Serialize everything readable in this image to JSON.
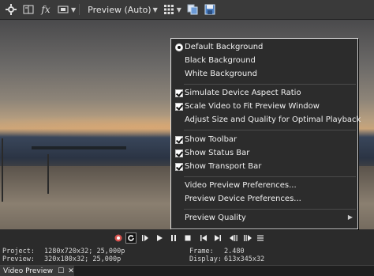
{
  "toolbar": {
    "preview_mode": "Preview (Auto)",
    "icons": [
      "gear-icon",
      "split-screen-icon",
      "fx-icon",
      "overlay-icon",
      "grid-icon",
      "copy-snapshot-icon",
      "save-snapshot-icon"
    ]
  },
  "menu": {
    "items": [
      {
        "label": "Default Background",
        "mark": "radio"
      },
      {
        "label": "Black Background",
        "mark": "none"
      },
      {
        "label": "White Background",
        "mark": "none"
      },
      {
        "label": "Simulate Device Aspect Ratio",
        "mark": "check"
      },
      {
        "label": "Scale Video to Fit Preview Window",
        "mark": "check"
      },
      {
        "label": "Adjust Size and Quality for Optimal Playback",
        "mark": "none"
      },
      {
        "label": "Show Toolbar",
        "mark": "check"
      },
      {
        "label": "Show Status Bar",
        "mark": "check"
      },
      {
        "label": "Show Transport Bar",
        "mark": "check"
      },
      {
        "label": "Video Preview Preferences...",
        "mark": "none"
      },
      {
        "label": "Preview Device Preferences...",
        "mark": "none"
      },
      {
        "label": "Preview Quality",
        "mark": "none",
        "submenu": true
      }
    ]
  },
  "transport": {
    "icons": [
      "record-icon",
      "loop-icon",
      "play-from-start-icon",
      "play-icon",
      "pause-icon",
      "stop-icon",
      "go-to-start-icon",
      "go-to-end-icon",
      "previous-frame-icon",
      "next-frame-icon",
      "more-icon"
    ]
  },
  "status": {
    "project_label": "Project:",
    "project_value": "1280x720x32; 25,000p",
    "preview_label": "Preview:",
    "preview_value": "320x180x32; 25,000p",
    "frame_label": "Frame:",
    "frame_value": "2.480",
    "display_label": "Display:",
    "display_value": "613x345x32"
  },
  "tab": {
    "label": "Video Preview"
  }
}
